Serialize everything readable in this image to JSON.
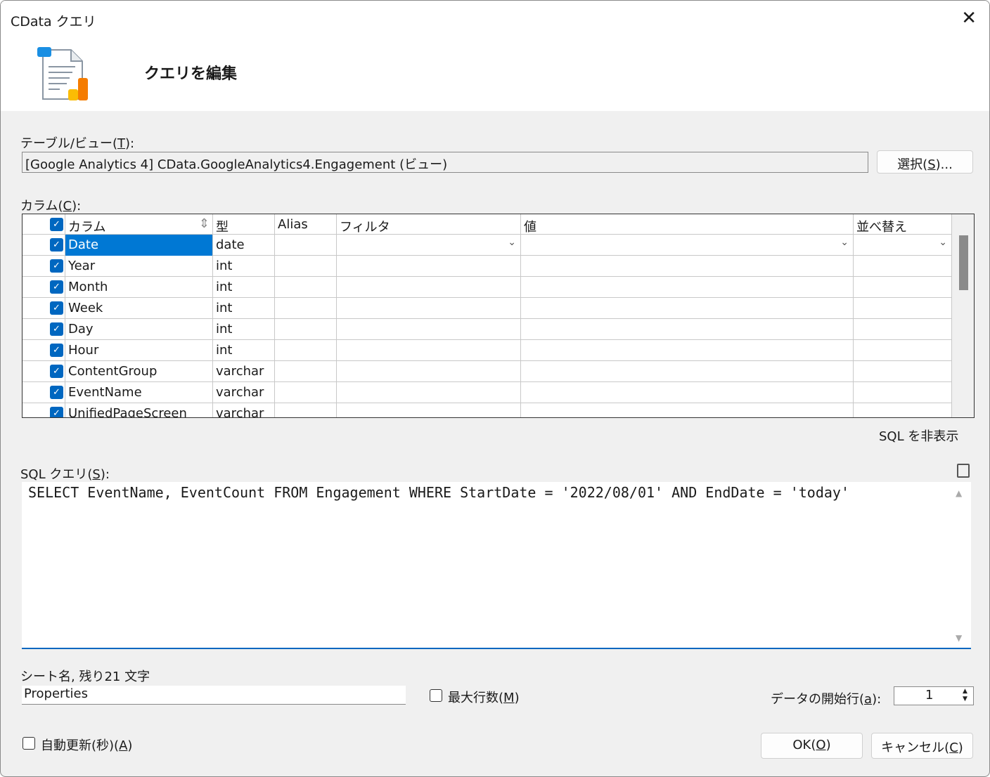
{
  "window": {
    "title": "CData クエリ",
    "header": "クエリを編集"
  },
  "table_view": {
    "label_pre": "テーブル/ビュー(",
    "label_key": "T",
    "label_post": "):",
    "value": "[Google Analytics 4] CData.GoogleAnalytics4.Engagement (ビュー)",
    "select_pre": "選択(",
    "select_key": "S",
    "select_post": ")..."
  },
  "columns": {
    "label_pre": "カラム(",
    "label_key": "C",
    "label_post": "):",
    "headers": [
      "カラム",
      "型",
      "Alias",
      "フィルタ",
      "値",
      "並べ替え"
    ],
    "rows": [
      {
        "name": "Date",
        "type": "date",
        "checked": true
      },
      {
        "name": "Year",
        "type": "int",
        "checked": true
      },
      {
        "name": "Month",
        "type": "int",
        "checked": true
      },
      {
        "name": "Week",
        "type": "int",
        "checked": true
      },
      {
        "name": "Day",
        "type": "int",
        "checked": true
      },
      {
        "name": "Hour",
        "type": "int",
        "checked": true
      },
      {
        "name": "ContentGroup",
        "type": "varchar",
        "checked": true
      },
      {
        "name": "EventName",
        "type": "varchar",
        "checked": true
      },
      {
        "name": "UnifiedPageScreen",
        "type": "varchar",
        "checked": true
      }
    ]
  },
  "sql": {
    "toggle": "SQL を非表示",
    "label_pre": "SQL クエリ(",
    "label_key": "S",
    "label_post": "):",
    "query": "SELECT EventName, EventCount FROM Engagement WHERE StartDate = '2022/08/01' AND EndDate = 'today'"
  },
  "sheet": {
    "label": "シート名, 残り21 文字",
    "value": "Properties"
  },
  "max_rows": {
    "pre": "最大行数(",
    "key": "M",
    "post": ")",
    "checked": false
  },
  "start_row": {
    "pre": "データの開始行(",
    "key": "a",
    "post": "):",
    "value": "1"
  },
  "auto_refresh": {
    "pre": "自動更新(秒)(",
    "key": "A",
    "post": ")",
    "checked": false
  },
  "buttons": {
    "ok_pre": "OK(",
    "ok_key": "O",
    "ok_post": ")",
    "cancel_pre": "キャンセル(",
    "cancel_key": "C",
    "cancel_post": ")"
  }
}
